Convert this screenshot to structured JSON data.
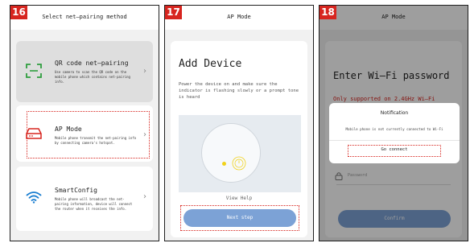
{
  "colors": {
    "accent_red": "#d7251f",
    "button_blue": "#7ca2d6",
    "wifi_blue": "#1c7fd1",
    "dot_yellow": "#f1d21a"
  },
  "screen16": {
    "badge": "16",
    "title": "Select net—pairing method",
    "qr": {
      "title": "QR code net—pairing",
      "desc": "Use camera to scan the QR code on the mobile phone which contains net-pairing info."
    },
    "ap": {
      "title": "AP Mode",
      "desc": "Mobile phone transmit the net-pairing info by connecting camera's hotspot."
    },
    "smart": {
      "title": "SmartConfig",
      "desc": "Mobile phone will broadcast the net-pairing information, device will connect the router when it receives the info."
    }
  },
  "screen17": {
    "badge": "17",
    "title": "AP Mode",
    "heading": "Add Device",
    "desc": "Power the device on and make sure the indicator is flashing slowly or a prompt tone is heard",
    "view_help": "View Help",
    "next": "Next step"
  },
  "screen18": {
    "badge": "18",
    "title": "AP Mode",
    "heading": "Enter Wi—Fi password",
    "note": "Only supported on 2.4GHz Wi—Fi",
    "password_placeholder": "Password",
    "confirm": "Confirm",
    "dialog": {
      "title": "Notification",
      "message": "Mobile phone is not currently connected to Wi-Fi",
      "action": "Go connect"
    }
  }
}
